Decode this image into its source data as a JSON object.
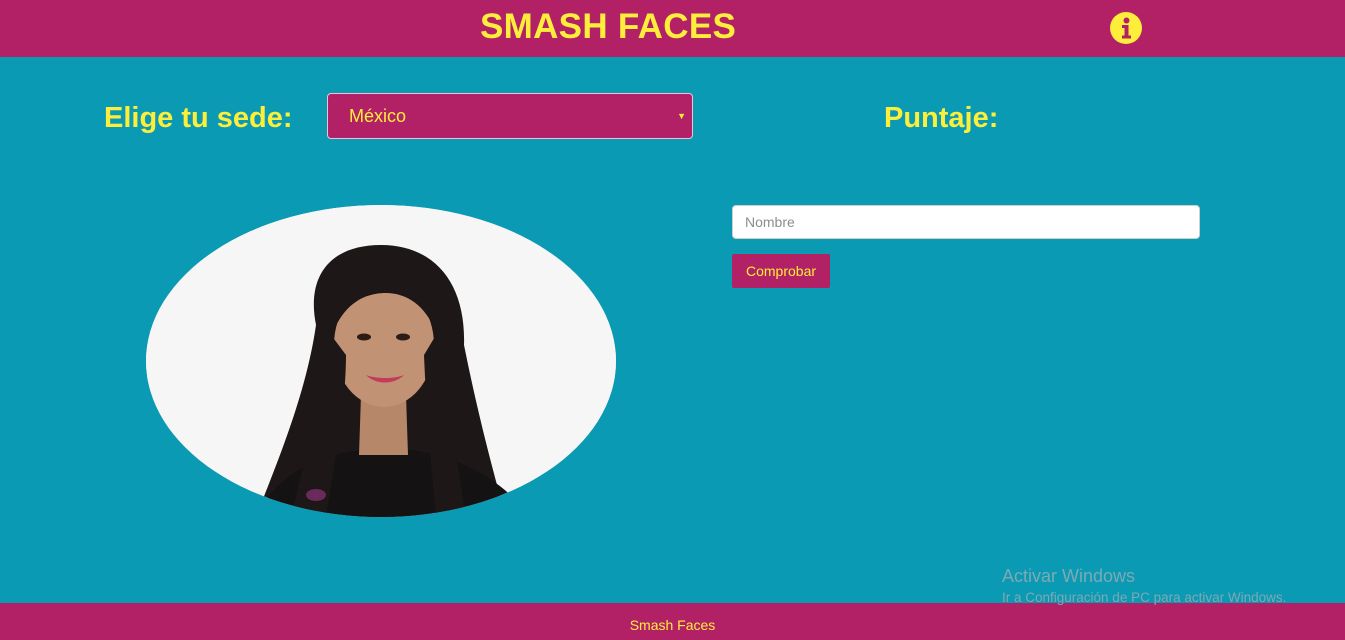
{
  "header": {
    "title": "SMASH FACES",
    "info_icon": "info-circle-icon"
  },
  "main": {
    "sede_label": "Elige tu sede:",
    "sede_select": {
      "selected": "México"
    },
    "score_label": "Puntaje:",
    "name_input": {
      "value": "",
      "placeholder": "Nombre"
    },
    "check_button": "Comprobar"
  },
  "footer": {
    "text": "Smash Faces"
  },
  "watermark": {
    "title": "Activar Windows",
    "subtitle": "Ir a Configuración de PC para activar Windows."
  },
  "colors": {
    "background": "#0a9ab3",
    "brand": "#b22166",
    "accent": "#fcee3a"
  }
}
